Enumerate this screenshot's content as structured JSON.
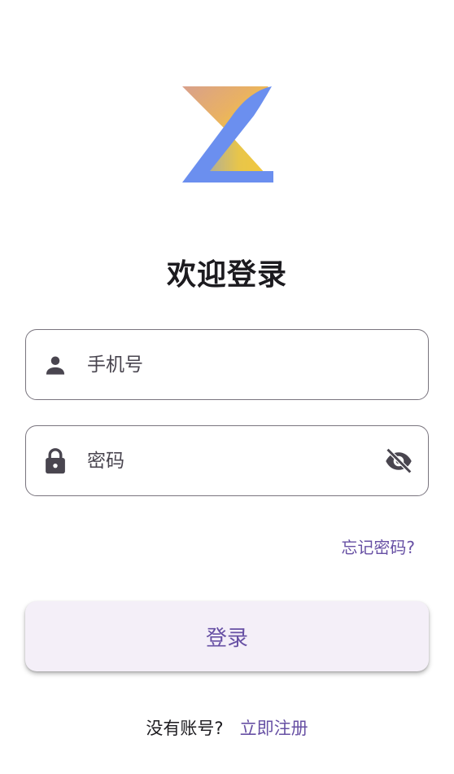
{
  "title": "欢迎登录",
  "phone_field": {
    "placeholder": "手机号",
    "icon": "person-icon"
  },
  "password_field": {
    "placeholder": "密码",
    "icon": "lock-icon",
    "toggle_icon": "visibility-off-icon"
  },
  "forgot_password": "忘记密码?",
  "login_button": "登录",
  "register": {
    "prompt": "没有账号?",
    "link": "立即注册"
  },
  "colors": {
    "primary": "#6750a4",
    "button_bg": "#f4eff8",
    "outline": "#79747e",
    "logo_blue": "#6b8fef",
    "logo_yellow": "#f4c93a",
    "logo_rose": "#d8a08c"
  }
}
